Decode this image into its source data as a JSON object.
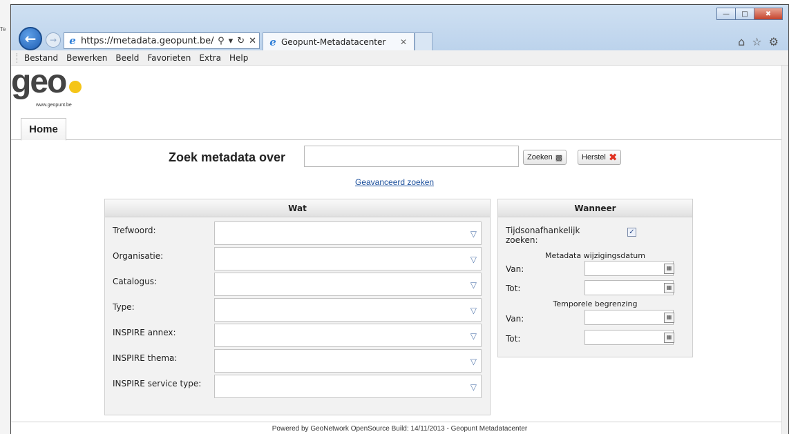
{
  "browser": {
    "url": "https://metadata.geopunt.be/",
    "tab_title": "Geopunt-Metadatacenter",
    "menu": [
      "Bestand",
      "Bewerken",
      "Beeld",
      "Favorieten",
      "Extra",
      "Help"
    ],
    "background_fragment": "Te"
  },
  "site": {
    "logo_text": "geo",
    "logo_url": "www.geopunt.be",
    "nav_tab": "Home"
  },
  "search": {
    "title": "Zoek metadata over",
    "value": "",
    "search_button": "Zoeken",
    "reset_button": "Herstel",
    "advanced_link": "Geavanceerd zoeken"
  },
  "wat": {
    "header": "Wat",
    "fields": [
      {
        "label": "Trefwoord:",
        "value": ""
      },
      {
        "label": "Organisatie:",
        "value": ""
      },
      {
        "label": "Catalogus:",
        "value": ""
      },
      {
        "label": "Type:",
        "value": ""
      },
      {
        "label": "INSPIRE annex:",
        "value": ""
      },
      {
        "label": "INSPIRE thema:",
        "value": ""
      },
      {
        "label": "INSPIRE service type:",
        "value": ""
      }
    ]
  },
  "wanneer": {
    "header": "Wanneer",
    "timeless_label_line1": "Tijdsonafhankelijk",
    "timeless_label_line2": "zoeken:",
    "timeless_checked": true,
    "meta_section": "Metadata wijzigingsdatum",
    "temporal_section": "Temporele begrenzing",
    "from_label": "Van:",
    "to_label": "Tot:"
  },
  "footer": {
    "text": "Powered by GeoNetwork OpenSource  Build: 14/11/2013 - Geopunt Metadatacenter"
  },
  "colors": {
    "link": "#1b4f9c",
    "titlebar": "#bcd3ec",
    "panel_bg": "#f2f2f2",
    "close_red": "#e03020",
    "logo_yellow": "#f5c518"
  }
}
